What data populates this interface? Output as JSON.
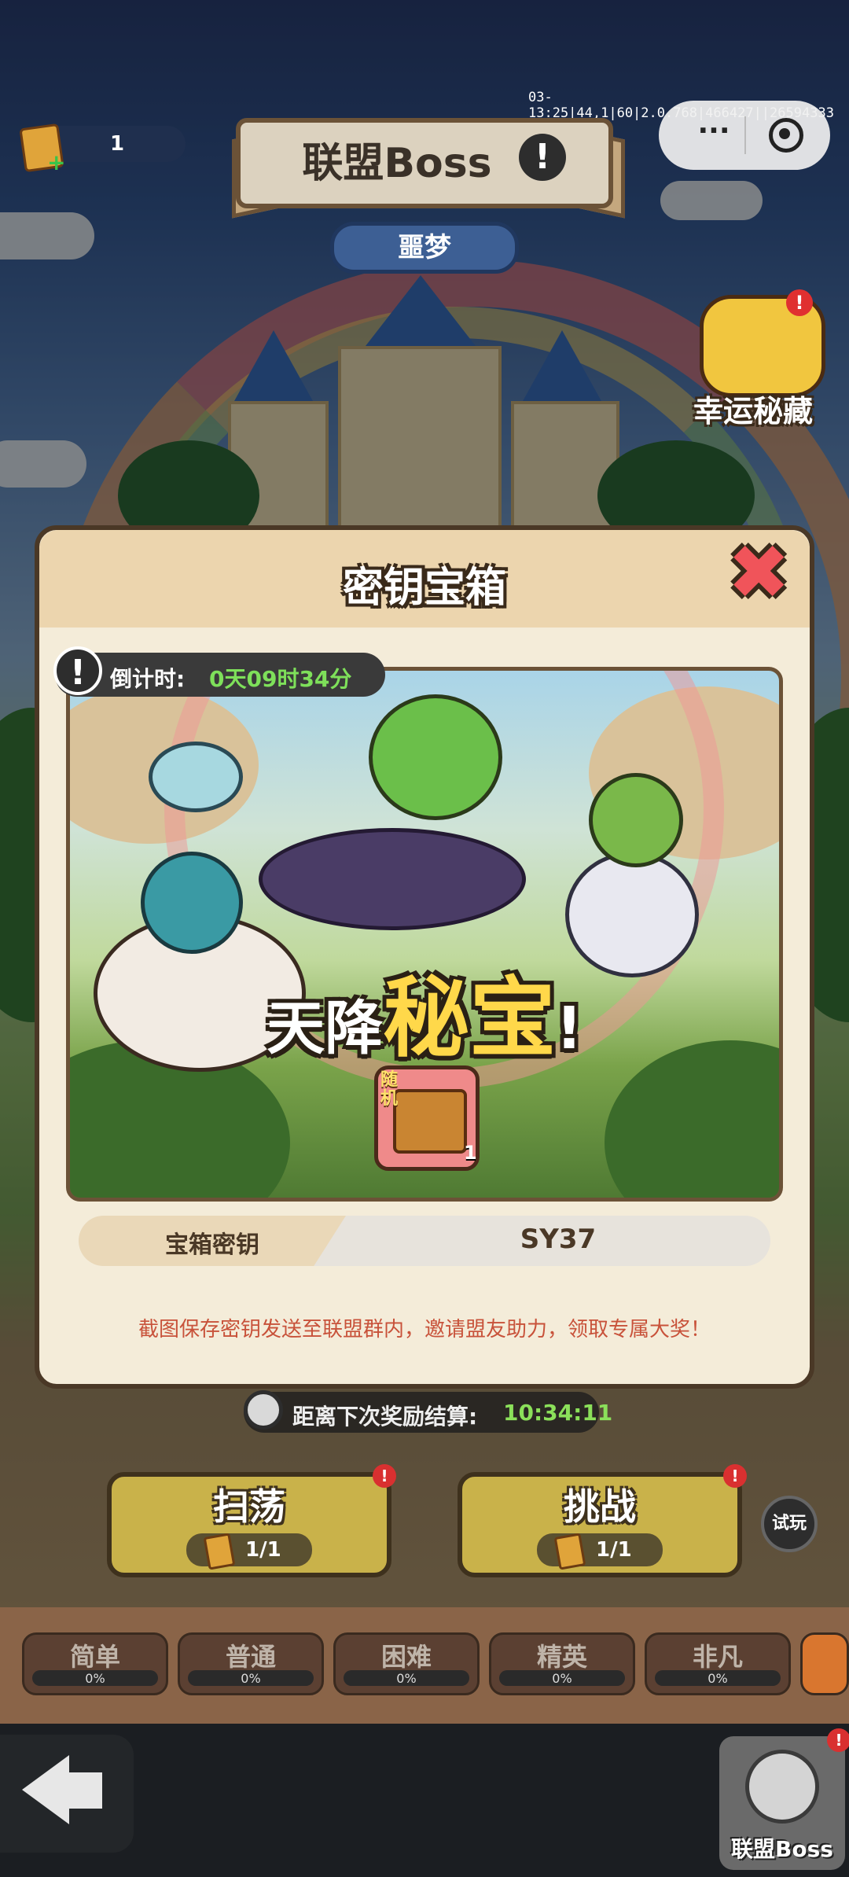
{
  "status": {
    "debug_text": "03-13:25|44,1|60|2.0.768|466427||26594333"
  },
  "top": {
    "key_count": "1",
    "title": "联盟Boss",
    "info_icon": "!",
    "difficulty": "噩梦",
    "lucky_label": "幸运秘藏",
    "lucky_badge": "!",
    "capsule_more": "···"
  },
  "modal": {
    "title": "密钥宝箱",
    "close_icon": "✖",
    "countdown_icon": "!",
    "countdown_label": "倒计时:",
    "countdown_value": "0天09时34分",
    "headline_a": "天降",
    "headline_b": "秘宝",
    "headline_c": "!",
    "chest_label": "随机",
    "chest_count": "1",
    "key_label": "宝箱密钥",
    "key_value": "SY37",
    "hint": "截图保存密钥发送至联盟群内，邀请盟友助力，领取专属大奖！"
  },
  "reward": {
    "label": "距离下次奖励结算:",
    "value": "10:34:11"
  },
  "actions": [
    {
      "label": "扫荡",
      "count": "1/1",
      "badge": "!"
    },
    {
      "label": "挑战",
      "count": "1/1",
      "badge": "!"
    }
  ],
  "trial_label": "试玩",
  "difficulties": [
    {
      "name": "简单",
      "pct": "0%"
    },
    {
      "name": "普通",
      "pct": "0%"
    },
    {
      "name": "困难",
      "pct": "0%"
    },
    {
      "name": "精英",
      "pct": "0%"
    },
    {
      "name": "非凡",
      "pct": "0%"
    }
  ],
  "nav": {
    "boss_label": "联盟Boss",
    "boss_badge": "!"
  },
  "colors": {
    "accent_green": "#7ee05a",
    "danger_red": "#d93030",
    "button_gold": "#c9b24a",
    "panel": "#f4ecd9"
  },
  "icons": {
    "back": "back-arrow-icon",
    "clock": "clock-icon",
    "close": "close-icon"
  }
}
